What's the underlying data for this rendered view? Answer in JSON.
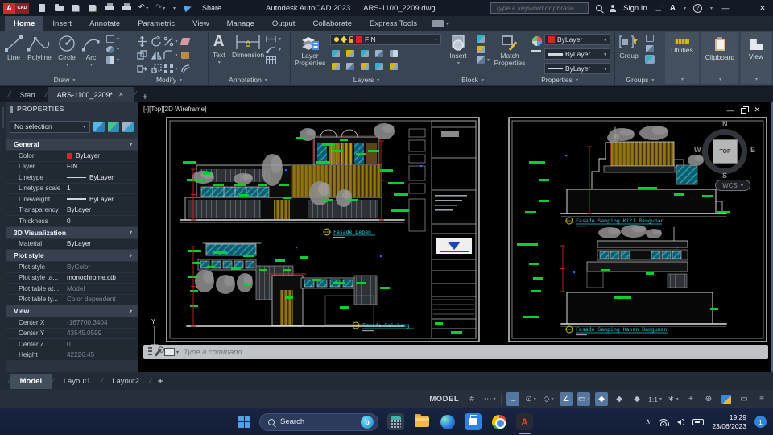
{
  "icons": {
    "caret": "▾",
    "close": "✕",
    "minimize": "—",
    "maximize": "□",
    "slash": "/",
    "plus": "+",
    "undo": "↶",
    "redo": "↷",
    "question": "?",
    "hamburger": "≡",
    "chevron_up": "∧",
    "grid": "#",
    "snap": "⋯",
    "ortho": "∟",
    "polar": "⊙",
    "iso": "◇",
    "otrack": "∠",
    "osnap": "▭",
    "annot_star": "◆",
    "gear": "∗",
    "isolate": "⊕",
    "monitor": "▭"
  },
  "colors": {
    "accent_blue": "#4a90d9",
    "layer_red": "#e02020",
    "tag_green": "#00d42a",
    "dim_red": "#cc2222",
    "label_cyan": "#1ac8dc",
    "slat_olive": "#8a6e14",
    "glass_teal": "#19798c"
  },
  "titlebar": {
    "app_title": "Autodesk AutoCAD 2023",
    "doc_title": "ARS-1100_2209.dwg",
    "share_label": "Share",
    "search_placeholder": "Type a keyword or phrase",
    "sign_in_label": "Sign In"
  },
  "ribbon": {
    "active_tab": "Home",
    "tabs": [
      "Home",
      "Insert",
      "Annotate",
      "Parametric",
      "View",
      "Manage",
      "Output",
      "Collaborate",
      "Express Tools"
    ],
    "draw": {
      "label": "Draw",
      "line": "Line",
      "polyline": "Polyline",
      "circle": "Circle",
      "arc": "Arc"
    },
    "modify": {
      "label": "Modify"
    },
    "annotation": {
      "label": "Annotation",
      "text": "Text",
      "dimension": "Dimension"
    },
    "layers": {
      "label": "Layers",
      "layer_properties": "Layer Properties",
      "current_layer": "FIN"
    },
    "block": {
      "label": "Block",
      "insert": "Insert"
    },
    "properties_panel": {
      "label": "Properties",
      "match": "Match Properties",
      "color_value": "ByLayer",
      "linetype_value": "ByLayer",
      "lineweight_value": "ByLayer"
    },
    "groups": {
      "label": "Groups",
      "group": "Group"
    },
    "utilities": {
      "label": "Utilities"
    },
    "clipboard": {
      "label": "Clipboard"
    },
    "view": {
      "label": "View"
    }
  },
  "file_tabs": [
    {
      "label": "Start",
      "active": false,
      "closable": false
    },
    {
      "label": "ARS-1100_2209*",
      "active": true,
      "closable": true
    }
  ],
  "properties_palette": {
    "title": "PROPERTIES",
    "selection": "No selection",
    "sections": [
      {
        "title": "General",
        "rows": [
          {
            "label": "Color",
            "value": "ByLayer",
            "swatch": true
          },
          {
            "label": "Layer",
            "value": "FIN"
          },
          {
            "label": "Linetype",
            "value": "ByLayer",
            "line": true
          },
          {
            "label": "Linetype scale",
            "value": "1"
          },
          {
            "label": "Lineweight",
            "value": "ByLayer",
            "thickline": true
          },
          {
            "label": "Transparency",
            "value": "ByLayer"
          },
          {
            "label": "Thickness",
            "value": "0"
          }
        ]
      },
      {
        "title": "3D Visualization",
        "rows": [
          {
            "label": "Material",
            "value": "ByLayer"
          }
        ]
      },
      {
        "title": "Plot style",
        "rows": [
          {
            "label": "Plot style",
            "value": "ByColor",
            "dim": true
          },
          {
            "label": "Plot style ta...",
            "value": "monochrome.ctb"
          },
          {
            "label": "Plot table at...",
            "value": "Model",
            "dim": true
          },
          {
            "label": "Plot table ty...",
            "value": "Color dependent",
            "dim": true
          }
        ]
      },
      {
        "title": "View",
        "rows": [
          {
            "label": "Center X",
            "value": "-167700.3404",
            "dim": true
          },
          {
            "label": "Center Y",
            "value": "43545.0599",
            "dim": true
          },
          {
            "label": "Center Z",
            "value": "0",
            "dim": true
          },
          {
            "label": "Height",
            "value": "42226.45",
            "dim": true
          }
        ]
      }
    ]
  },
  "viewport": {
    "label": "[-][Top][2D Wireframe]",
    "viewcube": {
      "n": "N",
      "e": "E",
      "s": "S",
      "w": "W",
      "top": "TOP",
      "wcs": "WCS"
    },
    "drawings": [
      {
        "label": "Fasade Depan"
      },
      {
        "label": "Fasade Belakang"
      },
      {
        "label": "Fasade Samping Kiri Bangunan"
      },
      {
        "label": "Fasade Samping Kanan Bangunan"
      }
    ]
  },
  "command_line": {
    "placeholder": "Type a command"
  },
  "layout_tabs": {
    "active": "Model",
    "tabs": [
      "Model",
      "Layout1",
      "Layout2"
    ]
  },
  "status_bar": {
    "model_label": "MODEL",
    "scale": "1:1"
  },
  "taskbar": {
    "search_placeholder": "Search",
    "time": "19:29",
    "date": "23/06/2023",
    "notification_count": "1"
  }
}
